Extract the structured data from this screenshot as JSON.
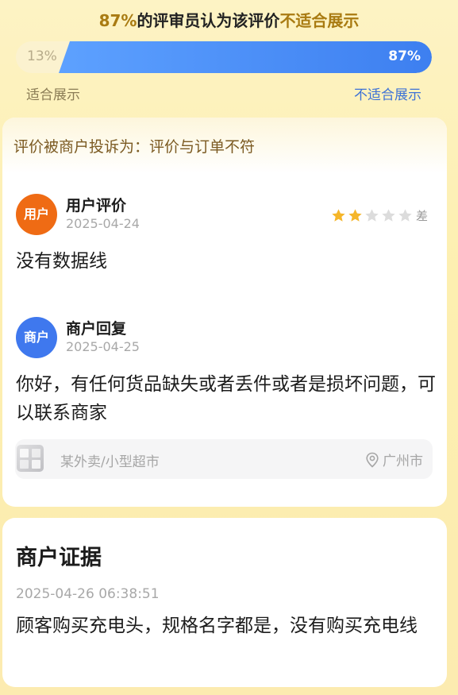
{
  "verdict": {
    "pct": "87%",
    "mid": "的评审员认为该评价",
    "result": "不适合展示"
  },
  "vote": {
    "suitable_pct": "13%",
    "unsuitable_pct": "87%",
    "unsuitable_fraction": 0.87,
    "suitable_label": "适合展示",
    "unsuitable_label": "不适合展示"
  },
  "complaint": {
    "text": "评价被商户投诉为：评价与订单不符"
  },
  "user_review": {
    "avatar_label": "用户",
    "title": "用户评价",
    "date": "2025-04-24",
    "stars_filled": 2,
    "stars_total": 5,
    "rating_label": "差",
    "content": "没有数据线"
  },
  "merchant_reply": {
    "avatar_label": "商户",
    "title": "商户回复",
    "date": "2025-04-25",
    "content": "你好，有任何货品缺失或者丢件或者是损坏问题，可以联系商家"
  },
  "store": {
    "name": "某外卖/小型超市",
    "city": "广州市"
  },
  "evidence": {
    "title": "商户证据",
    "time": "2025-04-26 06:38:51",
    "content": "顾客购买充电头，规格名字都是，没有购买充电线"
  },
  "colors": {
    "accent_gold": "#a97b12",
    "accent_blue": "#3d7ff0",
    "user_avatar": "#ef6b14",
    "merchant_avatar": "#3f78ee",
    "star_filled": "#f5b62a",
    "star_empty": "#dcdcdc"
  }
}
